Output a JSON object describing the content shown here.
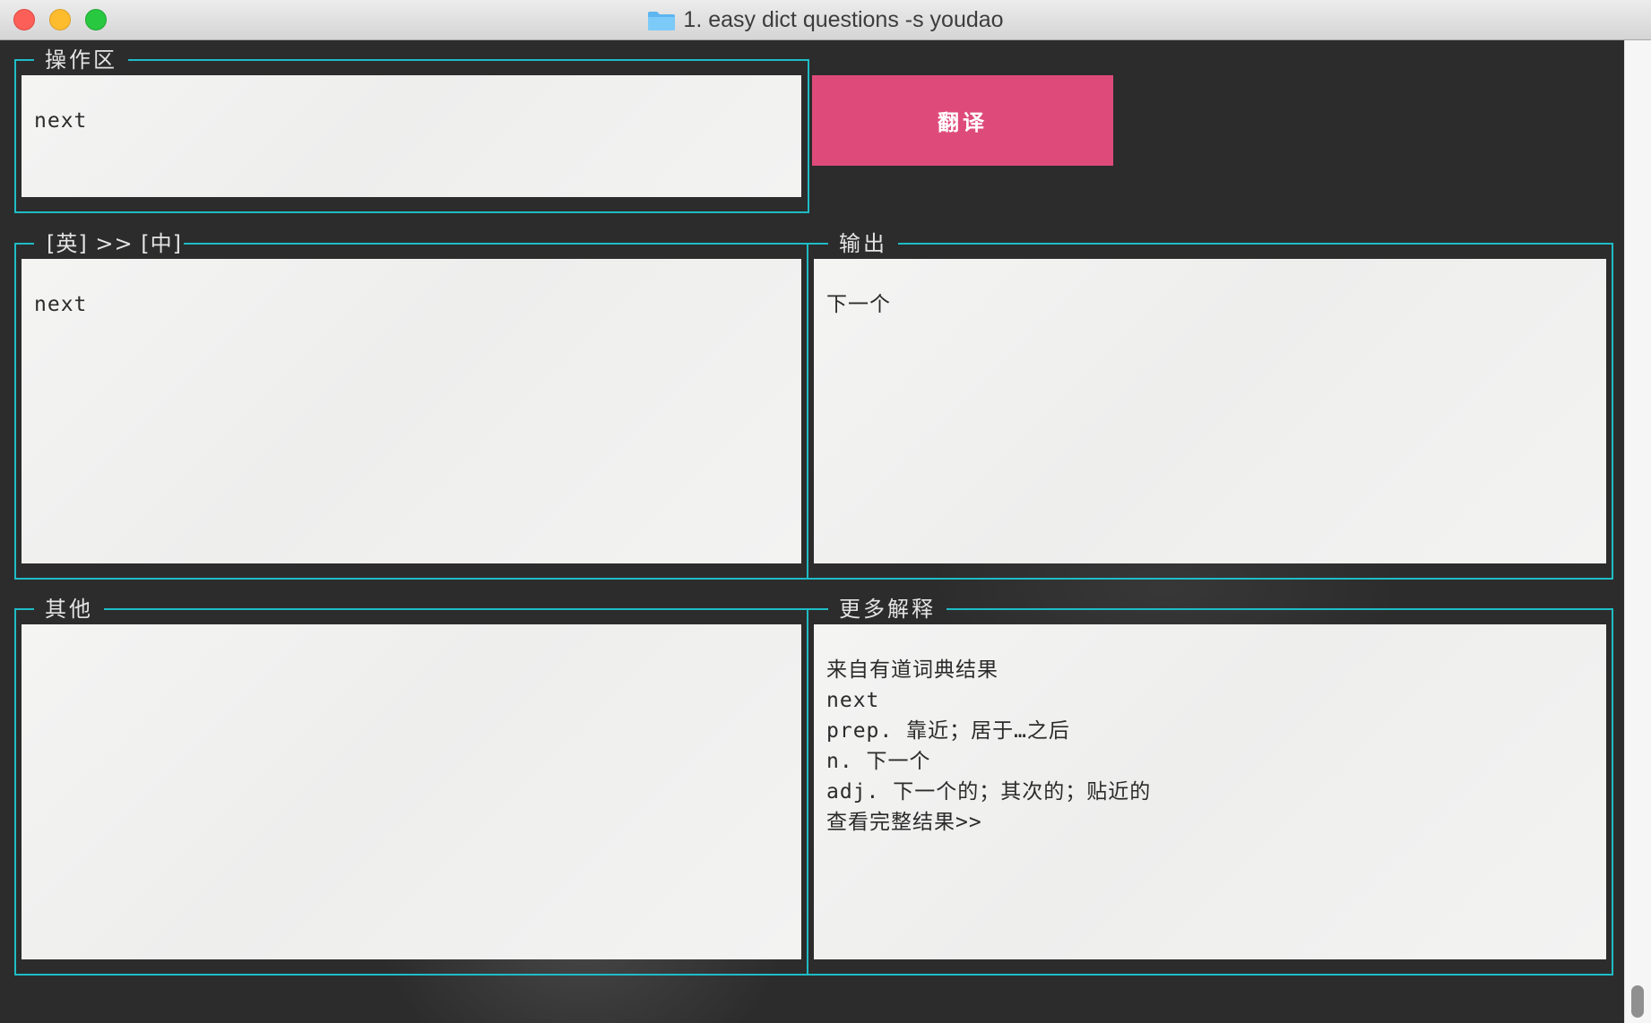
{
  "window": {
    "title": "1. easy dict questions -s youdao",
    "folder_icon": "folder-icon",
    "controls": [
      "close",
      "minimize",
      "zoom"
    ]
  },
  "operation": {
    "legend": "操作区",
    "input_value": "next",
    "translate_label": "翻译"
  },
  "source": {
    "legend": "[英] >> [中]",
    "text": "next"
  },
  "output": {
    "legend": "输出",
    "text": "下一个"
  },
  "other": {
    "legend": "其他",
    "text": ""
  },
  "more": {
    "legend": "更多解释",
    "lines": [
      "来自有道词典结果",
      "next",
      "prep. 靠近；居于…之后",
      "n. 下一个",
      "adj. 下一个的；其次的；贴近的",
      "查看完整结果>>"
    ]
  },
  "colors": {
    "background": "#2c2c2c",
    "border_accent": "#1fbcc6",
    "button": "#de4b7b",
    "panel": "#f2f2f1"
  }
}
